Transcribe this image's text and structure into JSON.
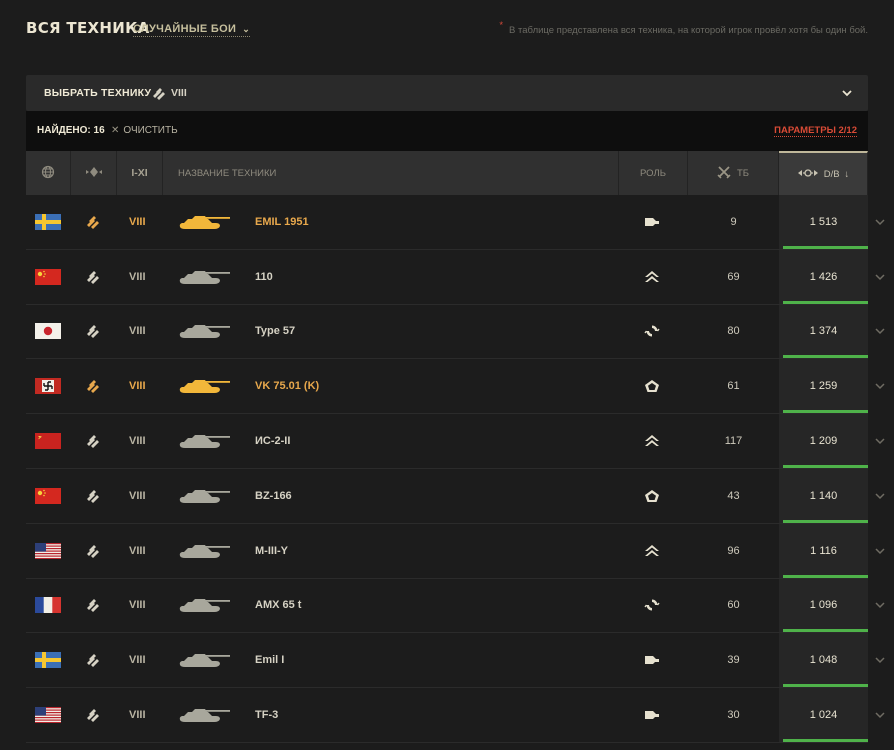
{
  "header": {
    "title": "ВСЯ ТЕХНИКА",
    "mode": "СЛУЧАЙНЫЕ БОИ",
    "note": "В таблице представлена вся техника, на которой игрок провёл хотя бы один бой."
  },
  "selector": {
    "label": "ВЫБРАТЬ ТЕХНИКУ",
    "tier": "VIII"
  },
  "filter": {
    "found": "НАЙДЕНО: 16",
    "clear": "ОЧИСТИТЬ",
    "params": "ПАРАМЕТРЫ 2/12"
  },
  "table_header": {
    "tier": "I-XI",
    "name": "НАЗВАНИЕ ТЕХНИКИ",
    "role": "РОЛЬ",
    "battles": "ТБ",
    "damage": "D/B"
  },
  "colors": {
    "accent_red": "#d94b36",
    "premium_gold": "#e8a84c",
    "bar_green": "#4fb24a"
  },
  "rows": [
    {
      "nation": "sweden",
      "tier": "VIII",
      "name": "EMIL 1951",
      "role": "heavy-tank-icon",
      "battles": "9",
      "damage": "1 513",
      "premium": true
    },
    {
      "nation": "china",
      "tier": "VIII",
      "name": "110",
      "role": "assault-icon",
      "battles": "69",
      "damage": "1 426",
      "premium": false
    },
    {
      "nation": "japan",
      "tier": "VIII",
      "name": "Type 57",
      "role": "universal-icon",
      "battles": "80",
      "damage": "1 374",
      "premium": false
    },
    {
      "nation": "germany",
      "tier": "VIII",
      "name": "VK 75.01 (K)",
      "role": "breakthrough-icon",
      "battles": "61",
      "damage": "1 259",
      "premium": true
    },
    {
      "nation": "ussr",
      "tier": "VIII",
      "name": "ИС-2-II",
      "role": "assault-icon",
      "battles": "117",
      "damage": "1 209",
      "premium": false
    },
    {
      "nation": "china",
      "tier": "VIII",
      "name": "BZ-166",
      "role": "breakthrough-icon",
      "battles": "43",
      "damage": "1 140",
      "premium": false
    },
    {
      "nation": "usa",
      "tier": "VIII",
      "name": "M-III-Y",
      "role": "assault-icon",
      "battles": "96",
      "damage": "1 116",
      "premium": false
    },
    {
      "nation": "france",
      "tier": "VIII",
      "name": "AMX 65 t",
      "role": "universal-icon",
      "battles": "60",
      "damage": "1 096",
      "premium": false
    },
    {
      "nation": "sweden",
      "tier": "VIII",
      "name": "Emil I",
      "role": "heavy-tank-icon",
      "battles": "39",
      "damage": "1 048",
      "premium": false
    },
    {
      "nation": "usa",
      "tier": "VIII",
      "name": "TF-3",
      "role": "heavy-tank-icon",
      "battles": "30",
      "damage": "1 024",
      "premium": false
    }
  ]
}
